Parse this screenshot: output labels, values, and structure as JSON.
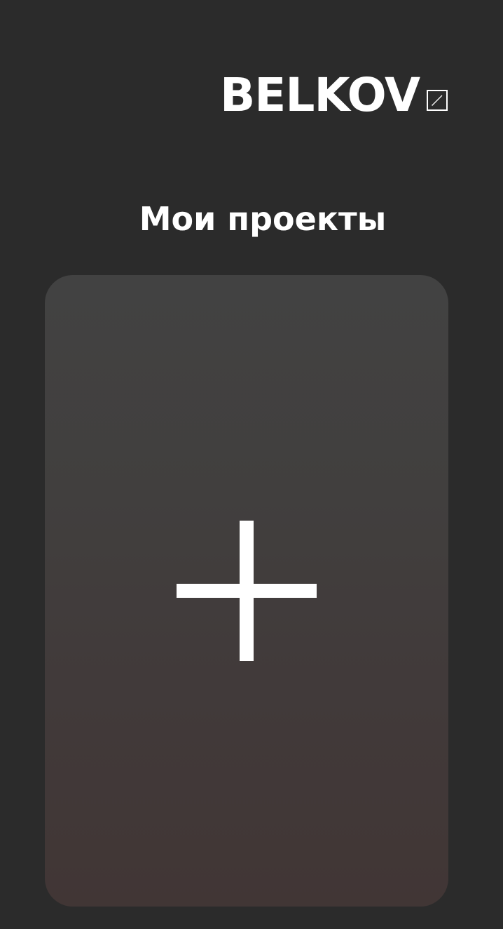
{
  "header": {
    "logo_text": "BELKOV",
    "logo_icon": "edit-square-icon"
  },
  "main": {
    "title": "Мои проекты",
    "add_card": {
      "icon": "plus-icon"
    }
  },
  "colors": {
    "background": "#2b2b2b",
    "card_top": "#424242",
    "card_bottom": "#413635",
    "foreground": "#ffffff"
  }
}
